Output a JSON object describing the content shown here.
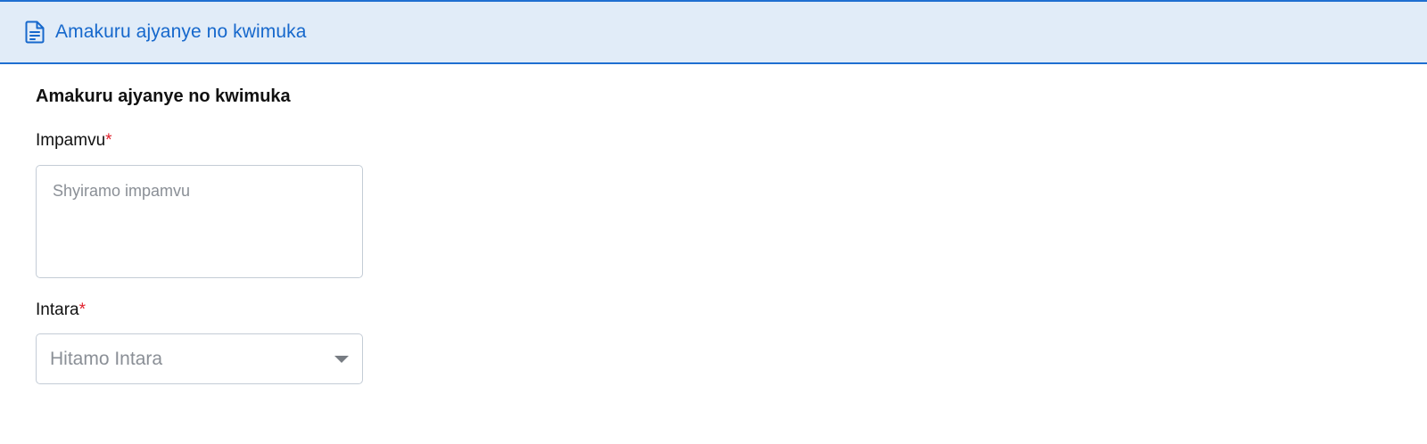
{
  "header": {
    "icon": "document-icon",
    "title": "Amakuru ajyanye no kwimuka",
    "accent_color": "#1668cc",
    "background_color": "#e1ecf8"
  },
  "form": {
    "section_title": "Amakuru ajyanye no kwimuka",
    "reason": {
      "label": "Impamvu",
      "required_marker": "*",
      "value": "",
      "placeholder": "Shyiramo impamvu"
    },
    "province": {
      "label": "Intara",
      "required_marker": "*",
      "selected": "Hitamo Intara",
      "icon": "chevron-down-icon"
    }
  }
}
